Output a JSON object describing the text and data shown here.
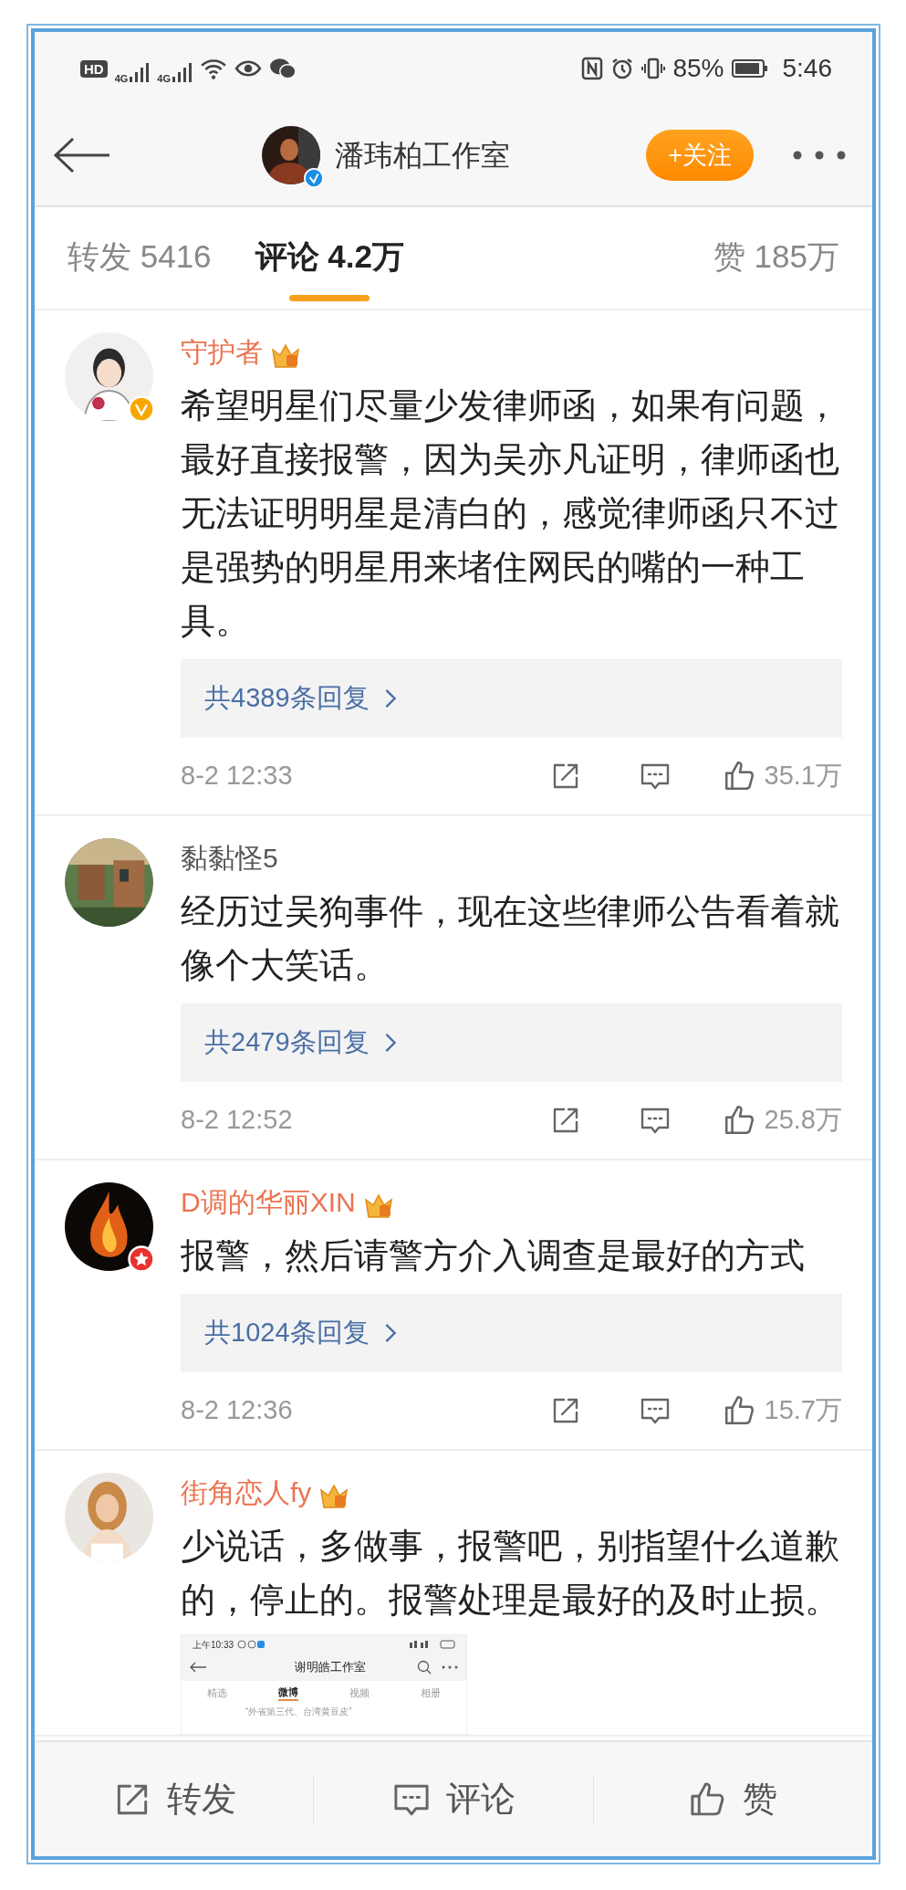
{
  "status_bar": {
    "hd_label": "HD",
    "sim_labels": [
      "4G",
      "4G"
    ],
    "battery": "85%",
    "time": "5:46"
  },
  "header": {
    "title": "潘玮柏工作室",
    "verified": true,
    "follow_button": "+关注"
  },
  "tabs": [
    {
      "label": "转发 5416",
      "selected": false
    },
    {
      "label": "评论 4.2万",
      "selected": true
    },
    {
      "label": "赞 185万",
      "selected": false
    }
  ],
  "comments": [
    {
      "name": "守护者",
      "vip": true,
      "verified": true,
      "text": "希望明星们尽量少发律师函，如果有问题，最好直接报警，因为吴亦凡证明，律师函也无法证明明星是清白的，感觉律师函只不过是强势的明星用来堵住网民的嘴的一种工具。",
      "replies": "共4389条回复",
      "time": "8-2 12:33",
      "likes": "35.1万"
    },
    {
      "name": "黏黏怪5",
      "vip": false,
      "text": "经历过吴狗事件，现在这些律师公告看着就像个大笑话。",
      "replies": "共2479条回复",
      "time": "8-2 12:52",
      "likes": "25.8万"
    },
    {
      "name": "D调的华丽XIN",
      "vip": true,
      "starred": true,
      "text": "报警，然后请警方介入调查是最好的方式",
      "replies": "共1024条回复",
      "time": "8-2 12:36",
      "likes": "15.7万"
    },
    {
      "name": "街角恋人fy",
      "vip": true,
      "text": "少说话，多做事，报警吧，别指望什么道歉的，停止的。报警处理是最好的及时止损。",
      "image": {
        "status_time": "上午10:33",
        "title": "谢明皓工作室",
        "tabs": [
          {
            "label": "精选",
            "selected": false
          },
          {
            "label": "微博",
            "selected": true
          },
          {
            "label": "视频",
            "selected": false
          },
          {
            "label": "相册",
            "selected": false
          }
        ],
        "quote": "“外省第三代、台湾黄豆皮”"
      }
    }
  ],
  "bottom_bar": [
    {
      "kind": "share",
      "label": "转发"
    },
    {
      "kind": "comment",
      "label": "评论"
    },
    {
      "kind": "like",
      "label": "赞"
    }
  ]
}
